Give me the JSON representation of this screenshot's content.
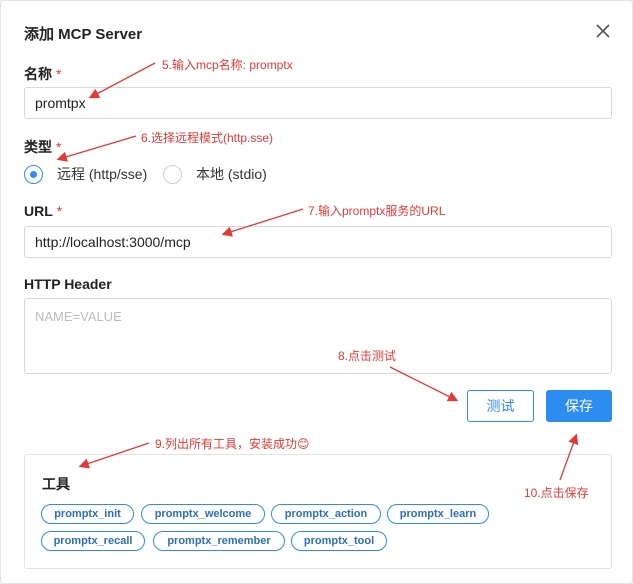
{
  "dialog": {
    "title": "添加 MCP Server",
    "close_icon": "close-icon"
  },
  "form": {
    "name_label": "名称",
    "name_required": "*",
    "name_value": "promtpx",
    "type_label": "类型",
    "type_required": "*",
    "type_options": [
      {
        "label": "远程 (http/sse)",
        "selected": true
      },
      {
        "label": "本地 (stdio)",
        "selected": false
      }
    ],
    "url_label": "URL",
    "url_required": "*",
    "url_value": "http://localhost:3000/mcp",
    "header_label": "HTTP Header",
    "header_placeholder": "NAME=VALUE"
  },
  "buttons": {
    "test": "测试",
    "save": "保存"
  },
  "tools": {
    "title": "工具",
    "items": [
      "promptx_init",
      "promptx_welcome",
      "promptx_action",
      "promptx_learn",
      "promptx_recall",
      "promptx_remember",
      "promptx_tool"
    ]
  },
  "annotations": {
    "a5": "5.输入mcp名称: promptx",
    "a6": "6.选择远程模式(http.sse)",
    "a7": "7.输入promptx服务的URL",
    "a8": "8.点击测试",
    "a9": "9.列出所有工具，安装成功😊",
    "a10": "10.点击保存"
  },
  "colors": {
    "accent": "#2d8cf0",
    "annotation": "#e53935"
  }
}
